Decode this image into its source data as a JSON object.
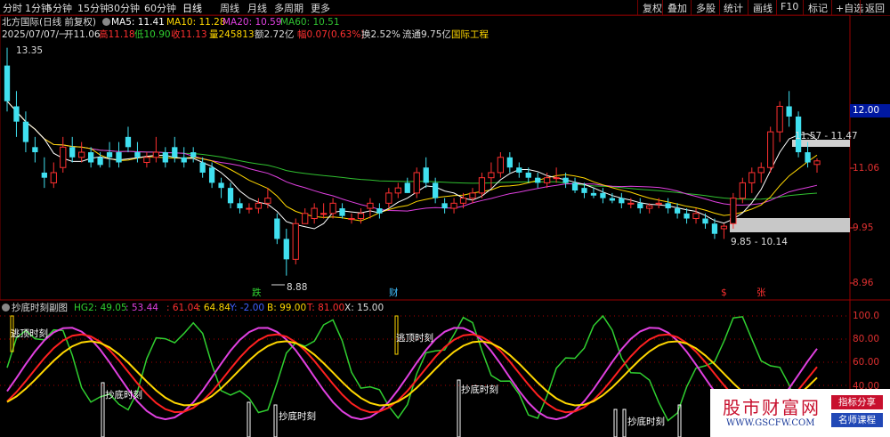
{
  "toolbar": {
    "left": [
      "分时",
      "1分钟",
      "5分钟",
      "15分钟",
      "30分钟",
      "60分钟",
      "日线",
      "周线",
      "月线",
      "多周期",
      "更多"
    ],
    "active": "日线",
    "right": [
      "复权",
      "叠加",
      "多股",
      "统计",
      "画线",
      "F10",
      "标记",
      "+自选",
      "返回"
    ]
  },
  "header": {
    "stock": "北方国际(日线 前复权)",
    "ma5": "MA5: 11.41",
    "ma10": "MA10: 11.28",
    "ma20": "MA20: 10.59",
    "ma60": "MA60: 10.51",
    "date": "2025/07/07/一",
    "open": "开11.06",
    "high": "高11.18",
    "low": "低10.90",
    "close": "收11.13",
    "vol": "量245813",
    "amt": "额2.72亿",
    "chg": "幅0.07(0.63%)",
    "turnover": "换2.52%",
    "float": "流通9.75亿",
    "sector": "国际工程"
  },
  "price_axis": [
    "12.00",
    "11.06",
    "9.95",
    "8.96"
  ],
  "price_current": "12.00",
  "annotations": {
    "high_label": "13.35",
    "low_label": "8.88",
    "range_top": "11.57 - 11.47",
    "range_bottom": "9.85 - 10.14",
    "marker_die": "跌",
    "marker_cai": "财",
    "marker_dollar": "$",
    "marker_zhang": "张"
  },
  "indicator": {
    "title": "抄底时刻副图",
    "hg2": "HG2: 49.05",
    "v2": ": 53.44",
    "v3": ": 61.04",
    "v4": ": 64.84",
    "y": "Y: -2.00",
    "b": "B: 99.00",
    "t": "T: 81.00",
    "x": "X: 15.00",
    "axis": [
      "100.0",
      "80.00",
      "60.00",
      "40.00",
      "20.00"
    ],
    "escape_label": "逃顶时刻",
    "bottom_label": "抄底时刻"
  },
  "watermark": {
    "title": "股市财富网",
    "url": "WWW.GSCFW.COM",
    "badge1": "指标分享",
    "badge2": "名师课程"
  },
  "colors": {
    "up": "#ff3030",
    "down": "#40e0f0",
    "ma5": "#ffffff",
    "ma10": "#ffd700",
    "ma20": "#e040e0",
    "ma60": "#30c030"
  },
  "chart_data": {
    "type": "candlestick",
    "candles": [
      [
        13.0,
        13.35,
        12.1,
        12.3
      ],
      [
        12.2,
        12.5,
        11.6,
        11.9
      ],
      [
        11.9,
        12.1,
        11.3,
        11.5
      ],
      [
        11.4,
        11.6,
        11.1,
        11.3
      ],
      [
        10.9,
        11.2,
        10.6,
        10.8
      ],
      [
        10.7,
        11.1,
        10.6,
        10.9
      ],
      [
        11.0,
        11.6,
        10.9,
        11.4
      ],
      [
        11.4,
        11.6,
        11.1,
        11.2
      ],
      [
        11.2,
        11.5,
        11.1,
        11.3
      ],
      [
        11.3,
        11.4,
        11.0,
        11.1
      ],
      [
        11.2,
        11.3,
        11.0,
        11.05
      ],
      [
        11.3,
        11.5,
        11.0,
        11.2
      ],
      [
        11.3,
        11.5,
        11.0,
        11.1
      ],
      [
        11.6,
        11.8,
        11.3,
        11.4
      ],
      [
        11.3,
        11.5,
        11.1,
        11.2
      ],
      [
        11.1,
        11.3,
        11.0,
        11.2
      ],
      [
        11.2,
        11.6,
        11.1,
        11.3
      ],
      [
        11.3,
        11.4,
        11.0,
        11.1
      ],
      [
        11.4,
        11.6,
        11.1,
        11.2
      ],
      [
        11.2,
        11.4,
        11.0,
        11.1
      ],
      [
        11.3,
        11.4,
        11.1,
        11.2
      ],
      [
        11.1,
        11.2,
        10.8,
        10.9
      ],
      [
        11.0,
        11.1,
        10.6,
        10.7
      ],
      [
        10.7,
        10.8,
        10.4,
        10.6
      ],
      [
        10.6,
        10.7,
        10.2,
        10.3
      ],
      [
        10.3,
        10.4,
        10.1,
        10.2
      ],
      [
        10.2,
        10.3,
        10.1,
        10.2
      ],
      [
        10.2,
        10.4,
        10.1,
        10.3
      ],
      [
        10.3,
        10.6,
        10.2,
        10.4
      ],
      [
        10.0,
        10.1,
        9.5,
        9.6
      ],
      [
        9.6,
        9.8,
        8.88,
        9.2
      ],
      [
        9.2,
        10.0,
        9.1,
        9.9
      ],
      [
        9.9,
        10.2,
        9.9,
        10.1
      ],
      [
        10.0,
        10.3,
        9.9,
        10.2
      ],
      [
        10.1,
        10.3,
        10.0,
        10.1
      ],
      [
        10.1,
        10.4,
        10.0,
        10.3
      ],
      [
        10.2,
        10.3,
        10.0,
        10.05
      ],
      [
        10.0,
        10.1,
        9.9,
        10.0
      ],
      [
        10.0,
        10.2,
        9.9,
        10.1
      ],
      [
        10.2,
        10.4,
        10.0,
        10.3
      ],
      [
        10.2,
        10.3,
        10.0,
        10.1
      ],
      [
        10.3,
        10.6,
        10.2,
        10.5
      ],
      [
        10.5,
        10.7,
        10.4,
        10.6
      ],
      [
        10.7,
        10.8,
        10.5,
        10.5
      ],
      [
        10.5,
        11.0,
        10.4,
        10.9
      ],
      [
        11.0,
        11.2,
        10.6,
        10.7
      ],
      [
        10.7,
        10.8,
        10.3,
        10.4
      ],
      [
        10.3,
        10.4,
        10.1,
        10.2
      ],
      [
        10.2,
        10.4,
        10.1,
        10.3
      ],
      [
        10.3,
        10.5,
        10.2,
        10.4
      ],
      [
        10.4,
        10.6,
        10.3,
        10.5
      ],
      [
        10.5,
        10.9,
        10.4,
        10.8
      ],
      [
        10.8,
        11.1,
        10.6,
        10.9
      ],
      [
        10.9,
        11.3,
        10.8,
        11.2
      ],
      [
        11.2,
        11.3,
        10.9,
        11.0
      ],
      [
        11.0,
        11.1,
        10.8,
        10.9
      ],
      [
        10.9,
        11.0,
        10.7,
        10.8
      ],
      [
        10.8,
        10.9,
        10.6,
        10.7
      ],
      [
        10.7,
        10.9,
        10.6,
        10.8
      ],
      [
        10.8,
        11.0,
        10.7,
        10.8
      ],
      [
        10.8,
        10.9,
        10.6,
        10.7
      ],
      [
        10.7,
        10.8,
        10.5,
        10.55
      ],
      [
        10.6,
        10.7,
        10.4,
        10.5
      ],
      [
        10.5,
        10.6,
        10.4,
        10.45
      ],
      [
        10.5,
        10.6,
        10.3,
        10.4
      ],
      [
        10.4,
        10.5,
        10.3,
        10.35
      ],
      [
        10.4,
        10.5,
        10.2,
        10.3
      ],
      [
        10.3,
        10.4,
        10.2,
        10.3
      ],
      [
        10.3,
        10.4,
        10.1,
        10.2
      ],
      [
        10.2,
        10.3,
        10.1,
        10.25
      ],
      [
        10.3,
        10.4,
        10.2,
        10.3
      ],
      [
        10.3,
        10.4,
        10.1,
        10.2
      ],
      [
        10.2,
        10.3,
        10.0,
        10.1
      ],
      [
        10.1,
        10.2,
        9.9,
        10.0
      ],
      [
        10.0,
        10.2,
        9.9,
        10.1
      ],
      [
        10.0,
        10.1,
        9.8,
        9.9
      ],
      [
        9.9,
        10.0,
        9.6,
        9.7
      ],
      [
        9.8,
        9.9,
        9.6,
        9.85
      ],
      [
        9.9,
        10.5,
        9.8,
        10.4
      ],
      [
        10.4,
        10.8,
        10.3,
        10.7
      ],
      [
        10.7,
        11.0,
        10.5,
        10.9
      ],
      [
        10.9,
        11.1,
        10.7,
        11.0
      ],
      [
        11.0,
        11.8,
        10.9,
        11.7
      ],
      [
        11.7,
        12.3,
        11.5,
        12.2
      ],
      [
        12.2,
        12.5,
        11.8,
        12.0
      ],
      [
        12.0,
        12.1,
        11.2,
        11.3
      ],
      [
        11.3,
        11.5,
        11.0,
        11.1
      ],
      [
        11.06,
        11.18,
        10.9,
        11.13
      ]
    ]
  }
}
